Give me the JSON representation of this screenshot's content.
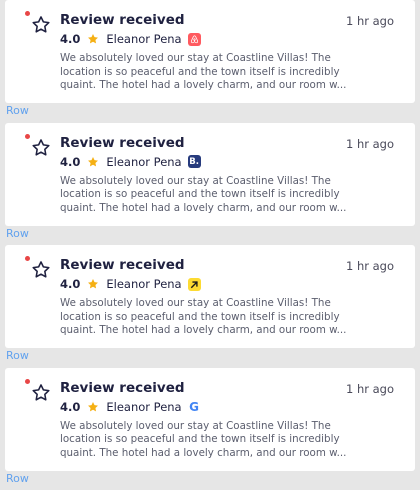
{
  "notifications": [
    {
      "title": "Review received",
      "rating": "4.0",
      "reviewer": "Eleanor Pena",
      "source_icon": "airbnb-icon",
      "time": "1 hr ago",
      "body": {
        "line1": "We absolutely loved our stay at Coastline Villas! The",
        "line2": "location is so peaceful and the town itself is incredibly",
        "line3": "quaint. The hotel had a lovely charm, and our room w..."
      },
      "row_label": "Row"
    },
    {
      "title": "Review received",
      "rating": "4.0",
      "reviewer": "Eleanor Pena",
      "source_icon": "booking-icon",
      "source_letter": "B.",
      "time": "1 hr ago",
      "body": {
        "line1": "We absolutely loved our stay at Coastline Villas! The",
        "line2": "location is so peaceful and the town itself is incredibly",
        "line3": "quaint. The hotel had a lovely charm, and our room w..."
      },
      "row_label": "Row"
    },
    {
      "title": "Review received",
      "rating": "4.0",
      "reviewer": "Eleanor Pena",
      "source_icon": "expedia-icon",
      "time": "1 hr ago",
      "body": {
        "line1": "We absolutely loved our stay at Coastline Villas! The",
        "line2": "location is so peaceful and the town itself is incredibly",
        "line3": "quaint. The hotel had a lovely charm, and our room w..."
      },
      "row_label": "Row"
    },
    {
      "title": "Review received",
      "rating": "4.0",
      "reviewer": "Eleanor Pena",
      "source_icon": "google-icon",
      "source_letter": "G",
      "time": "1 hr ago",
      "body": {
        "line1": "We absolutely loved our stay at Coastline Villas! The",
        "line2": "location is so peaceful and the town itself is incredibly",
        "line3": "quaint. The hotel had a lovely charm, and our room w..."
      },
      "row_label": "Row"
    }
  ],
  "colors": {
    "unread_dot": "#e84646",
    "rating_star": "#f5b014",
    "airbnb": "#ff5a5f",
    "booking": "#273b7d",
    "expedia": "#fddb32",
    "google_blue": "#4285f4",
    "row_label": "#62a2ee"
  }
}
